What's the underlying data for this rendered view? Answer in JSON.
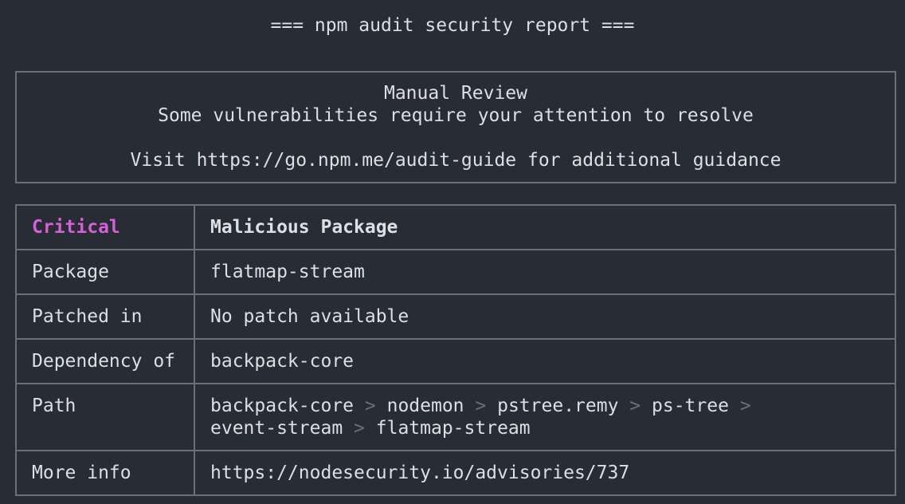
{
  "terminal": {
    "title": "=== npm audit security report ==="
  },
  "review": {
    "heading": "Manual Review",
    "message": "Some vulnerabilities require your attention to resolve",
    "guide": "Visit https://go.npm.me/audit-guide for additional guidance"
  },
  "advisory": {
    "severity": "Critical",
    "title": "Malicious Package",
    "rows": [
      {
        "key": "Package",
        "value": "flatmap-stream"
      },
      {
        "key": "Patched in",
        "value": "No patch available"
      },
      {
        "key": "Dependency of",
        "value": "backpack-core"
      },
      {
        "key": "Path"
      },
      {
        "key": "More info",
        "value": "https://nodesecurity.io/advisories/737"
      }
    ],
    "path_nodes": [
      "backpack-core",
      "nodemon",
      "pstree.remy",
      "ps-tree",
      "event-stream",
      "flatmap-stream"
    ],
    "path_separator": ">"
  },
  "colors": {
    "background": "#282c34",
    "text": "#dcdfe4",
    "border": "#6b6f76",
    "critical": "#d75fd7"
  }
}
